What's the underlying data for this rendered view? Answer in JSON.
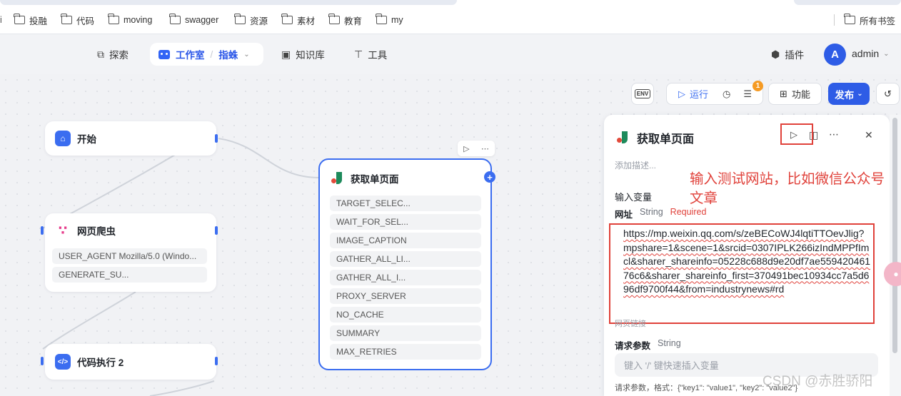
{
  "bookmarks": {
    "items": [
      {
        "label": "投融",
        "icon": "folder-icon"
      },
      {
        "label": "代码",
        "icon": "folder-icon"
      },
      {
        "label": "moving",
        "icon": "folder-icon"
      },
      {
        "label": "swagger",
        "icon": "folder-icon"
      },
      {
        "label": "资源",
        "icon": "folder-icon"
      },
      {
        "label": "素材",
        "icon": "folder-icon"
      },
      {
        "label": "教育",
        "icon": "folder-icon"
      },
      {
        "label": "my",
        "icon": "folder-icon"
      }
    ],
    "all_bookmarks": "所有书签"
  },
  "header": {
    "explore": "探索",
    "studio": "工作室",
    "separator": "/",
    "project": "指蛛",
    "knowledge": "知识库",
    "tools": "工具",
    "plugins": "插件",
    "avatar_letter": "A",
    "username": "admin"
  },
  "toolbar": {
    "env": "ENV",
    "run": "运行",
    "badge_count": "1",
    "features": "功能",
    "publish": "发布"
  },
  "nodes": {
    "start": {
      "title": "开始"
    },
    "crawler": {
      "title": "网页爬虫",
      "fields": [
        "USER_AGENT Mozilla/5.0 (Windo...",
        "GENERATE_SU..."
      ]
    },
    "code": {
      "title": "代码执行 2"
    },
    "fetch": {
      "title": "获取单页面",
      "fields": [
        "TARGET_SELEC...",
        "WAIT_FOR_SEL...",
        "IMAGE_CAPTION",
        "GATHER_ALL_LI...",
        "GATHER_ALL_I...",
        "PROXY_SERVER",
        "NO_CACHE",
        "SUMMARY",
        "MAX_RETRIES"
      ]
    }
  },
  "panel": {
    "title": "获取单页面",
    "description_placeholder": "添加描述...",
    "input_vars_label": "输入变量",
    "url_label": "网址",
    "url_type": "String",
    "url_required": "Required",
    "url_value": "https://mp.weixin.qq.com/s/zeBECoWJ4lqtiTTOevJlig?mpshare=1&scene=1&srcid=0307IPLK266izIndMPPfImcl&sharer_shareinfo=05228c688d9e20df7ae55942046176c6&sharer_shareinfo_first=370491bec10934cc7a5d696df9700f44&from=industrynews#rd",
    "url_hint": "网页链接",
    "params_label": "请求参数",
    "params_type": "String",
    "params_placeholder": "键入 '/' 键快速插入变量",
    "params_help": "请求参数，格式：{\"key1\": \"value1\", \"key2\": \"value2\"}"
  },
  "annotation": {
    "note": "输入测试网站，比如微信公众号文章"
  },
  "watermark": "CSDN @赤胜骄阳",
  "colors": {
    "accent": "#2e5ce6",
    "annotation_red": "#e0413a"
  }
}
